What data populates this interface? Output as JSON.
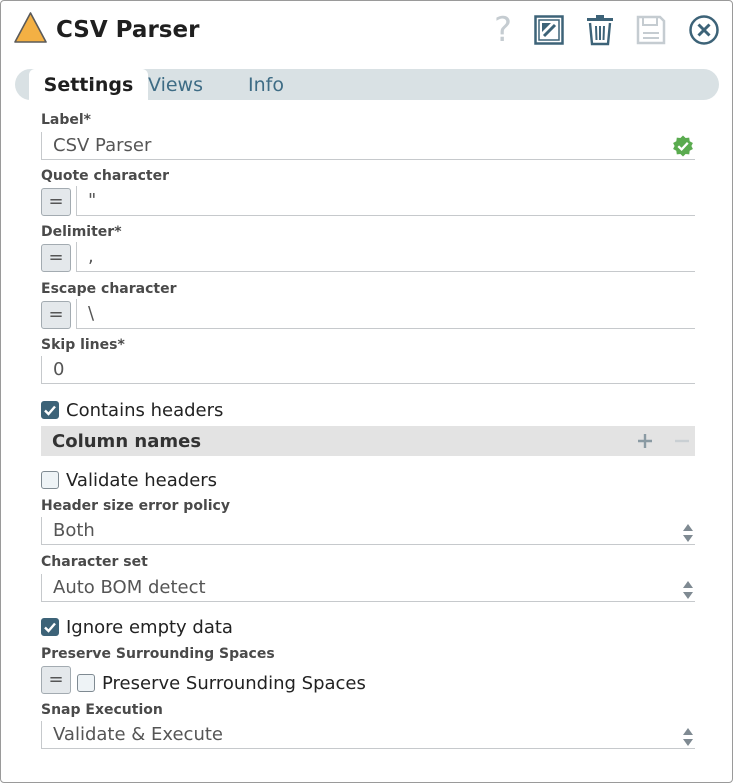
{
  "header": {
    "title": "CSV Parser",
    "icons": [
      "warning-triangle-icon",
      "help-icon",
      "export-icon",
      "trash-icon",
      "save-icon",
      "close-icon"
    ],
    "accent": "#f3b044"
  },
  "tabs": [
    {
      "label": "Settings",
      "active": true
    },
    {
      "label": "Views",
      "active": false
    },
    {
      "label": "Info",
      "active": false
    }
  ],
  "form": {
    "label": {
      "title": "Label*",
      "value": "CSV Parser"
    },
    "quote": {
      "title": "Quote character",
      "value": "\"",
      "expr": "="
    },
    "delimiter": {
      "title": "Delimiter*",
      "value": ",",
      "expr": "="
    },
    "escape": {
      "title": "Escape character",
      "value": "\\",
      "expr": "="
    },
    "skip_lines": {
      "title": "Skip lines*",
      "value": "0"
    },
    "contains_headers": {
      "label": "Contains headers",
      "checked": true
    },
    "column_names": {
      "title": "Column names"
    },
    "validate_headers": {
      "label": "Validate headers",
      "checked": false
    },
    "header_policy": {
      "title": "Header size error policy",
      "value": "Both"
    },
    "charset": {
      "title": "Character set",
      "value": "Auto BOM detect"
    },
    "ignore_empty": {
      "label": "Ignore empty data",
      "checked": true
    },
    "preserve": {
      "title": "Preserve Surrounding Spaces",
      "label": "Preserve Surrounding Spaces",
      "checked": false,
      "expr": "="
    },
    "snap_exec": {
      "title": "Snap Execution",
      "value": "Validate & Execute"
    }
  },
  "colors": {
    "tab_bg": "#d9e1e4",
    "checkbox_checked": "#3d6378",
    "valid_green": "#5aab4f"
  }
}
